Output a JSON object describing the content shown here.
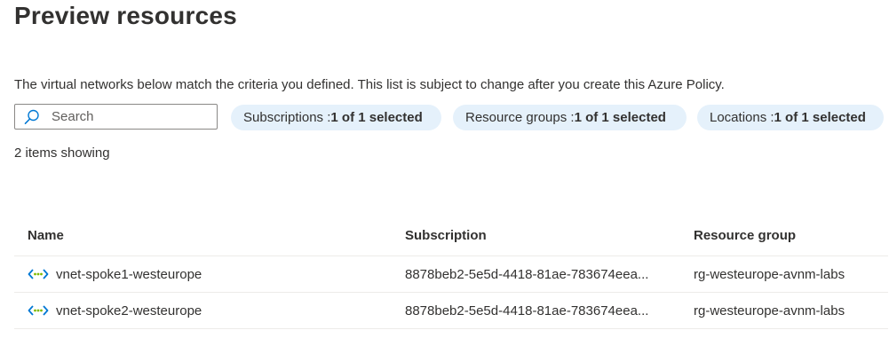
{
  "page": {
    "title": "Preview resources",
    "description": "The virtual networks below match the criteria you defined. This list is subject to change after you create this Azure Policy."
  },
  "search": {
    "placeholder": "Search",
    "icon": "search-icon"
  },
  "filters": [
    {
      "label": "Subscriptions : ",
      "value": "1 of 1 selected"
    },
    {
      "label": "Resource groups : ",
      "value": "1 of 1 selected"
    },
    {
      "label": "Locations : ",
      "value": "1 of 1 selected"
    }
  ],
  "items_count": "2 items showing",
  "table": {
    "columns": [
      "Name",
      "Subscription",
      "Resource group"
    ],
    "rows": [
      {
        "icon": "virtual-network-icon",
        "name": "vnet-spoke1-westeurope",
        "subscription": "8878beb2-5e5d-4418-81ae-783674eea...",
        "resource_group": "rg-westeurope-avnm-labs"
      },
      {
        "icon": "virtual-network-icon",
        "name": "vnet-spoke2-westeurope",
        "subscription": "8878beb2-5e5d-4418-81ae-783674eea...",
        "resource_group": "rg-westeurope-avnm-labs"
      }
    ]
  },
  "colors": {
    "pill_background": "#e5f1fb",
    "border": "#8a8886",
    "row_divider": "#edebe9",
    "icon_blue": "#0078d4",
    "icon_green": "#7fba00"
  }
}
